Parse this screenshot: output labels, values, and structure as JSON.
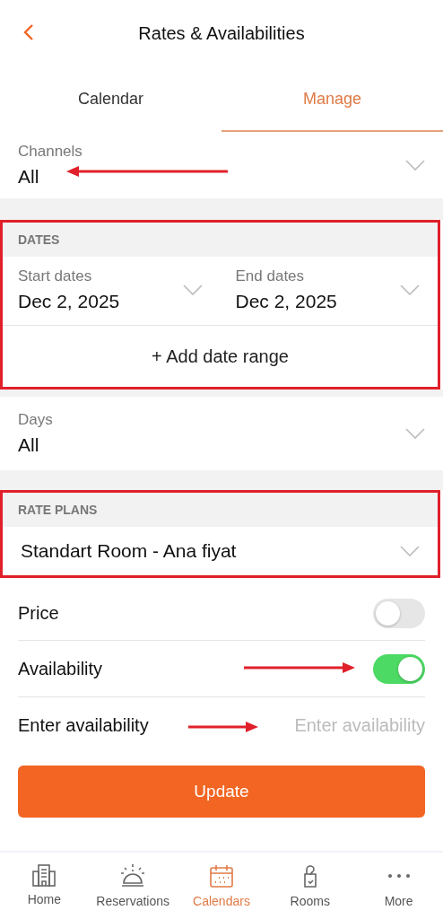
{
  "header": {
    "title": "Rates & Availabilities"
  },
  "tabs": [
    {
      "label": "Calendar",
      "selected": false
    },
    {
      "label": "Manage",
      "selected": true
    }
  ],
  "channels": {
    "label": "Channels",
    "value": "All",
    "annotated": true
  },
  "dates": {
    "heading": "DATES",
    "highlighted": true,
    "start": {
      "label": "Start dates",
      "value": "Dec 2, 2025"
    },
    "end": {
      "label": "End dates",
      "value": "Dec 2, 2025"
    },
    "add_range": "+ Add date range"
  },
  "days": {
    "label": "Days",
    "value": "All",
    "annotated": false
  },
  "rate_plans": {
    "heading": "RATE PLANS",
    "highlighted": true,
    "value": "Standart Room - Ana fiyat"
  },
  "toggles": [
    {
      "label": "Price",
      "on": false,
      "annotated": false
    },
    {
      "label": "Availability",
      "on": true,
      "annotated": true
    }
  ],
  "availability_input": {
    "label": "Enter availability",
    "placeholder": "Enter availability",
    "annotated": true
  },
  "update_button": "Update",
  "nav": [
    {
      "label": "Home",
      "kind": "building",
      "selected": false
    },
    {
      "label": "Reservations",
      "kind": "bell",
      "selected": false
    },
    {
      "label": "Calendars",
      "kind": "calendar",
      "selected": true
    },
    {
      "label": "Rooms",
      "kind": "hanger",
      "selected": false
    },
    {
      "label": "More",
      "kind": "dots",
      "selected": false
    }
  ]
}
